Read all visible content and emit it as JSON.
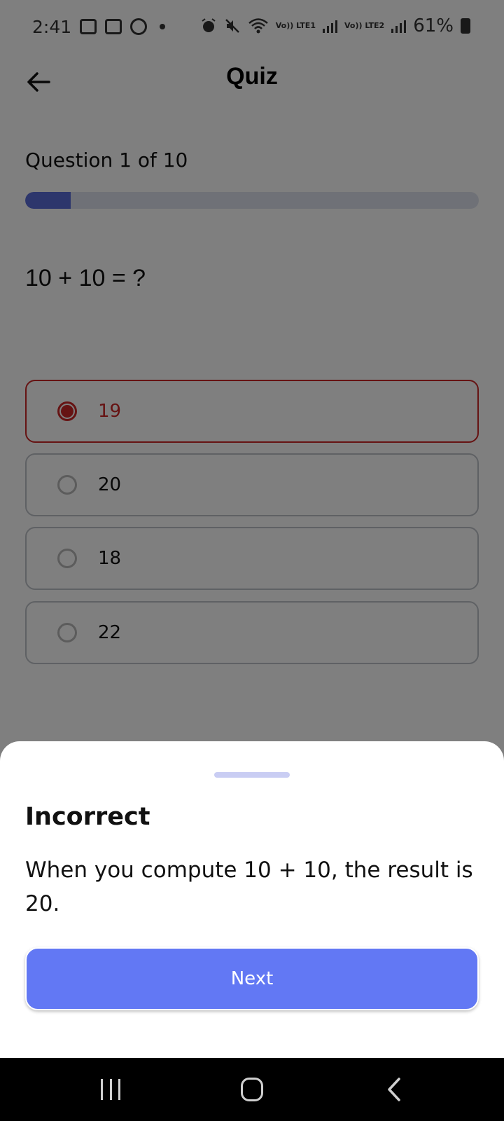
{
  "status_bar": {
    "time": "2:41",
    "battery": "61%",
    "lte1": "Vo)) LTE1",
    "lte2": "Vo)) LTE2"
  },
  "header": {
    "title": "Quiz"
  },
  "quiz": {
    "question_count": "Question 1 of 10",
    "progress_fraction": 0.1,
    "question": "10 + 10 = ?",
    "options": [
      {
        "label": "19",
        "selected": true
      },
      {
        "label": "20",
        "selected": false
      },
      {
        "label": "18",
        "selected": false
      },
      {
        "label": "22",
        "selected": false
      }
    ]
  },
  "feedback_sheet": {
    "title": "Incorrect",
    "message": "When you compute 10 + 10, the result is 20.",
    "next_label": "Next"
  },
  "colors": {
    "accent": "#6278f4",
    "progress_fill": "#5b6cd9",
    "incorrect": "#cc2626"
  },
  "icons": {
    "back": "arrow-left-icon",
    "nav_recent": "recent-apps-icon",
    "nav_home": "home-icon",
    "nav_back": "chevron-left-icon"
  }
}
